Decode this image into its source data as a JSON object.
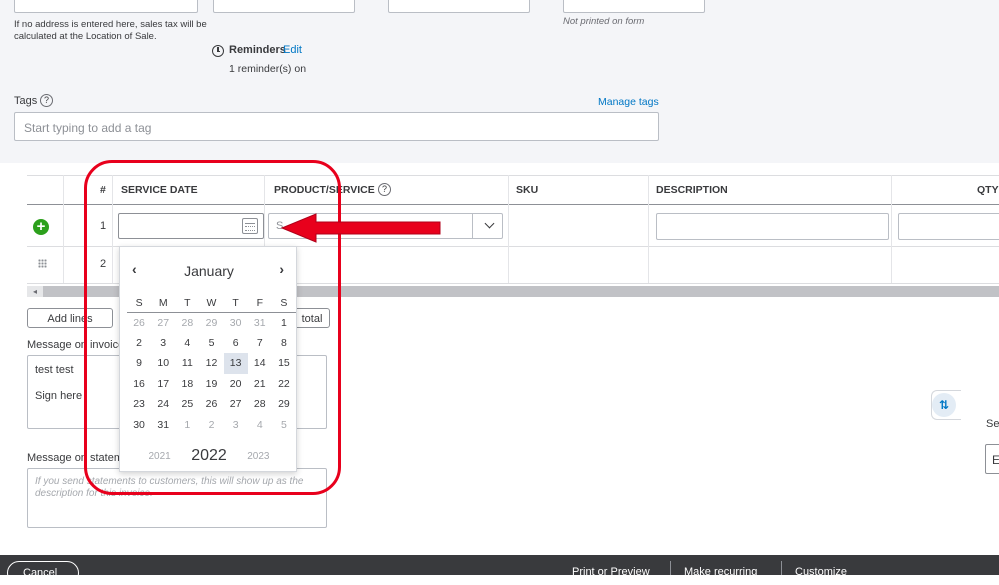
{
  "address_note": "If no address is entered here, sales tax will be calculated at the Location of Sale.",
  "not_printed_note": "Not printed on form",
  "reminders": {
    "label": "Reminders",
    "edit_link": "Edit",
    "status": "1 reminder(s) on"
  },
  "tags": {
    "label": "Tags",
    "help": "?",
    "manage_link": "Manage tags",
    "placeholder": "Start typing to add a tag"
  },
  "table": {
    "headers": {
      "num": "#",
      "service_date": "SERVICE DATE",
      "product_service": "PRODUCT/SERVICE",
      "sku": "SKU",
      "description": "DESCRIPTION",
      "qty": "QTY"
    },
    "product_help": "?",
    "product_placeholder": "S",
    "rows": [
      {
        "num": "1"
      },
      {
        "num": "2"
      }
    ]
  },
  "calendar": {
    "month": "January",
    "prev": "‹",
    "next": "›",
    "weekdays": [
      "S",
      "M",
      "T",
      "W",
      "T",
      "F",
      "S"
    ],
    "weeks": [
      [
        "26",
        "27",
        "28",
        "29",
        "30",
        "31",
        "1"
      ],
      [
        "2",
        "3",
        "4",
        "5",
        "6",
        "7",
        "8"
      ],
      [
        "9",
        "10",
        "11",
        "12",
        "13",
        "14",
        "15"
      ],
      [
        "16",
        "17",
        "18",
        "19",
        "20",
        "21",
        "22"
      ],
      [
        "23",
        "24",
        "25",
        "26",
        "27",
        "28",
        "29"
      ],
      [
        "30",
        "31",
        "1",
        "2",
        "3",
        "4",
        "5"
      ]
    ],
    "today": "13",
    "years": [
      "2021",
      "2022",
      "2023"
    ]
  },
  "buttons": {
    "add_lines": "Add lines",
    "subtotal_partial": "total"
  },
  "message_invoice": {
    "label": "Message on invoice",
    "line1": "test test",
    "line2": "Sign here"
  },
  "message_statement": {
    "label": "Message on statement",
    "placeholder": "If you send statements to customers, this will show up as the description for this invoice."
  },
  "right_partial": {
    "label": "Se",
    "field": "E"
  },
  "footer": {
    "left": "Cancel",
    "print": "Print or Preview",
    "recurring": "Make recurring",
    "customize": "Customize"
  },
  "colors": {
    "accent": "#0077c5",
    "add_green": "#2ca01c",
    "annotation_red": "#e8001c",
    "footer": "#393a3d"
  }
}
